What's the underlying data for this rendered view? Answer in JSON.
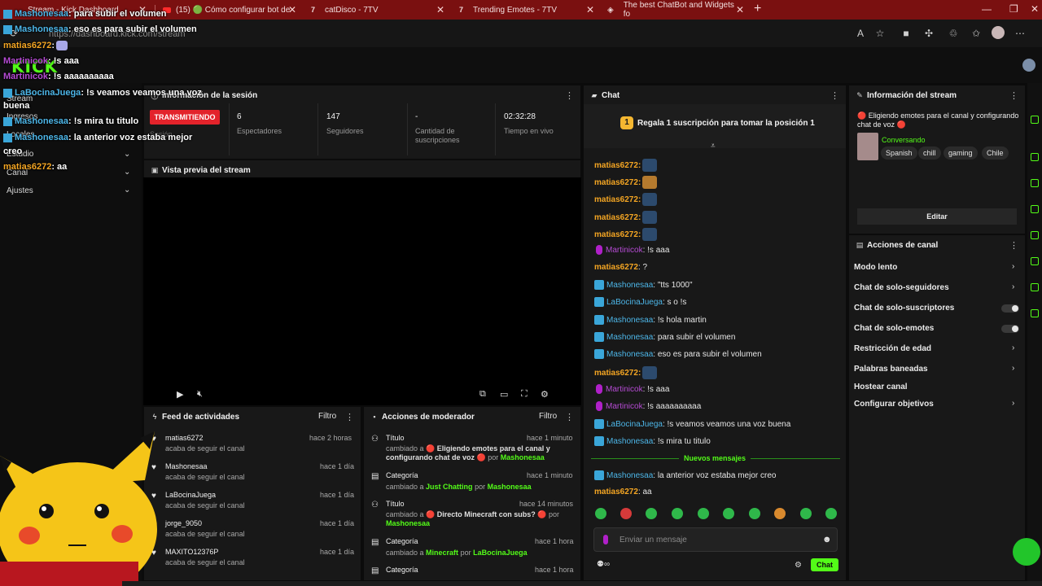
{
  "browser": {
    "tabs": [
      {
        "label": "Stream - Kick Dashboard"
      },
      {
        "label": "(15) 🟢 Cómo configurar bot de"
      },
      {
        "label": "catDisco - 7TV"
      },
      {
        "label": "Trending Emotes - 7TV"
      },
      {
        "label": "The best ChatBot and Widgets fo"
      }
    ],
    "url": "https://dashboard.kick.com/stream",
    "new_tab": "+",
    "min": "—",
    "max": "❐",
    "close": "✕"
  },
  "kick": {
    "logo": "KICK"
  },
  "sidebar": {
    "items": [
      {
        "label": "Stream"
      },
      {
        "label": "Ingresos"
      },
      {
        "label": "Locales"
      },
      {
        "label": "Estudio"
      },
      {
        "label": "Canal"
      },
      {
        "label": "Ajustes"
      }
    ]
  },
  "session": {
    "title": "Información de la sesión",
    "status": "TRANSMITIENDO",
    "status_sub": "Sesión",
    "stats": [
      {
        "value": "6",
        "label": "Espectadores"
      },
      {
        "value": "147",
        "label": "Seguidores"
      },
      {
        "value": "-",
        "label": "Cantidad de suscripciones"
      },
      {
        "value": "02:32:28",
        "label": "Tiempo en vivo"
      }
    ]
  },
  "preview": {
    "title": "Vista previa del stream"
  },
  "feed": {
    "title": "Feed de actividades",
    "filter": "Filtro",
    "rows": [
      {
        "name": "matias6272",
        "sub": "acaba de seguir el canal",
        "time": "hace 2 horas"
      },
      {
        "name": "Mashonesaa",
        "sub": "acaba de seguir el canal",
        "time": "hace 1 día"
      },
      {
        "name": "LaBocinaJuega",
        "sub": "acaba de seguir el canal",
        "time": "hace 1 día"
      },
      {
        "name": "jorge_9050",
        "sub": "acaba de seguir el canal",
        "time": "hace 1 día"
      },
      {
        "name": "MAXITO12376P",
        "sub": "acaba de seguir el canal",
        "time": "hace 1 día"
      }
    ]
  },
  "mod": {
    "title": "Acciones de moderador",
    "filter": "Filtro",
    "rows": [
      {
        "type": "Título",
        "time": "hace 1 minuto",
        "pre": "cambiado a",
        "value": "🔴 Eligiendo emotes para el canal y configurando chat de voz 🔴",
        "por": "por",
        "user": "Mashonesaa"
      },
      {
        "type": "Categoría",
        "time": "hace 1 minuto",
        "pre": "cambiado a",
        "value": "Just Chatting",
        "por": "por",
        "user": "Mashonesaa"
      },
      {
        "type": "Título",
        "time": "hace 14 minutos",
        "pre": "cambiado a",
        "value": "🔴 Directo Minecraft con subs? 🔴",
        "por": "por",
        "user": "Mashonesaa"
      },
      {
        "type": "Categoría",
        "time": "hace 1 hora",
        "pre": "cambiado a",
        "value": "Minecraft",
        "por": "por",
        "user": "LaBocinaJuega"
      },
      {
        "type": "Categoría",
        "time": "hace 1 hora"
      }
    ]
  },
  "chat": {
    "title": "Chat",
    "banner": "Regala 1 suscripción para tomar la posición 1",
    "banner_num": "1",
    "messages": [
      {
        "user": "matias6272",
        "text": ""
      },
      {
        "user": "matias6272",
        "text": ""
      },
      {
        "user": "matias6272",
        "text": ""
      },
      {
        "user": "matias6272",
        "text": ""
      },
      {
        "user": "matias6272",
        "text": ""
      },
      {
        "user": "Martinicok",
        "text": ": !s aaa"
      },
      {
        "user": "matias6272",
        "text": ": ?"
      },
      {
        "user": "Mashonesaa",
        "text": ": \"tts 1000\""
      },
      {
        "user": "LaBocinaJuega",
        "text": ": s o !s"
      },
      {
        "user": "Mashonesaa",
        "text": ": !s hola martin"
      },
      {
        "user": "Mashonesaa",
        "text": ": para subir el volumen"
      },
      {
        "user": "Mashonesaa",
        "text": ": eso es para subir el volumen"
      },
      {
        "user": "matias6272",
        "text": ""
      },
      {
        "user": "Martinicok",
        "text": ": !s aaa"
      },
      {
        "user": "Martinicok",
        "text": ": !s aaaaaaaaaa"
      },
      {
        "user": "LaBocinaJuega",
        "text": ": !s veamos veamos una voz buena"
      },
      {
        "user": "Mashonesaa",
        "text": ": !s mira tu titulo"
      },
      {
        "user": "Mashonesaa",
        "text": ": la anterior voz estaba mejor creo"
      },
      {
        "user": "matias6272",
        "text": ": aa"
      }
    ],
    "new_messages": "Nuevos mensajes",
    "input_placeholder": "Enviar un mensaje",
    "send": "Chat"
  },
  "info": {
    "title": "Información del stream",
    "stream_title": "🔴 Eligiendo emotes para el canal y configurando chat de voz 🔴",
    "category": "Conversando",
    "tags": [
      "Spanish",
      "chill",
      "gaming",
      "Chile"
    ],
    "edit": "Editar"
  },
  "channel_actions": {
    "title": "Acciones de canal",
    "items": [
      {
        "label": "Modo lento",
        "control": "chevron"
      },
      {
        "label": "Chat de solo-seguidores",
        "control": "chevron"
      },
      {
        "label": "Chat de solo-suscriptores",
        "control": "toggle"
      },
      {
        "label": "Chat de solo-emotes",
        "control": "toggle"
      },
      {
        "label": "Restricción de edad",
        "control": "chevron"
      },
      {
        "label": "Palabras baneadas",
        "control": "chevron"
      },
      {
        "label": "Hostear canal",
        "control": "none"
      },
      {
        "label": "Configurar objetivos",
        "control": "chevron"
      }
    ]
  },
  "overlay": {
    "lines": [
      {
        "user": "Mashonesaa",
        "text": ": para subir el volumen",
        "bot": true
      },
      {
        "user": "Mashonesaa",
        "text": ": eso es para subir el volumen",
        "bot": true
      },
      {
        "user": "matias6272",
        "text": ":",
        "bot": false
      },
      {
        "user": "Martinicok",
        "text": ": !s aaa",
        "bot": false
      },
      {
        "user": "Martinicok",
        "text": ": !s aaaaaaaaaa",
        "bot": false
      },
      {
        "user": "LaBocinaJuega",
        "text": ": !s veamos veamos una voz",
        "bot": true
      },
      {
        "user": "",
        "text": "buena",
        "bot": false
      },
      {
        "user": "Mashonesaa",
        "text": ": !s mira tu titulo",
        "bot": true
      },
      {
        "user": "Mashonesaa",
        "text": ": la anterior voz estaba mejor",
        "bot": true
      },
      {
        "user": "",
        "text": "creo",
        "bot": false
      },
      {
        "user": "matias6272",
        "text": ": aa",
        "bot": false
      }
    ]
  },
  "colors": {
    "accent": "#53fc18",
    "live": "#e3232b",
    "tabbar": "#7a1010",
    "user_orange": "#f5a623",
    "user_blue": "#4db6e8",
    "user_purple": "#b54bd3"
  }
}
